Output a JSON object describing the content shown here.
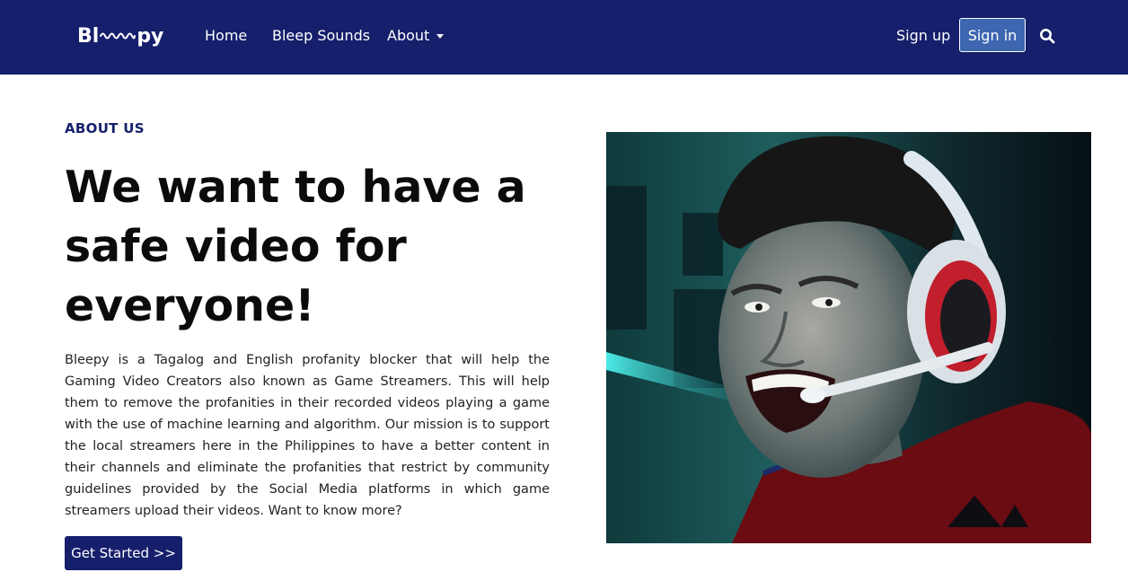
{
  "nav": {
    "logo": {
      "left": "Bl",
      "right": "py"
    },
    "links": {
      "home": "Home",
      "sounds": "Bleep Sounds",
      "about": "About"
    },
    "signup": "Sign up",
    "signin": "Sign in",
    "icons": {
      "search": "search-icon",
      "caret": "chevron-down-icon",
      "logo_wave": "sound-wave-icon"
    }
  },
  "hero": {
    "eyebrow": "ABOUT US",
    "headline": "We want to have a safe video for everyone!",
    "description": "Bleepy is a Tagalog and English profanity blocker that will help the Gaming Video Creators also known as Game Streamers. This will help them to remove the profanities in their recorded videos playing a game with the use of machine learning and algorithm. Our mission is to support the local streamers here in the Philippines to have a better content in their channels and eliminate the profanities that restrict by community guidelines provided by the Social Media platforms in which game streamers upload their videos. Want to know more?",
    "cta": "Get Started >>"
  },
  "colors": {
    "navbar": "#151f6b",
    "signin_button": "#3e66b1",
    "cta_button": "#151f6b",
    "eyebrow": "#151f6b"
  }
}
